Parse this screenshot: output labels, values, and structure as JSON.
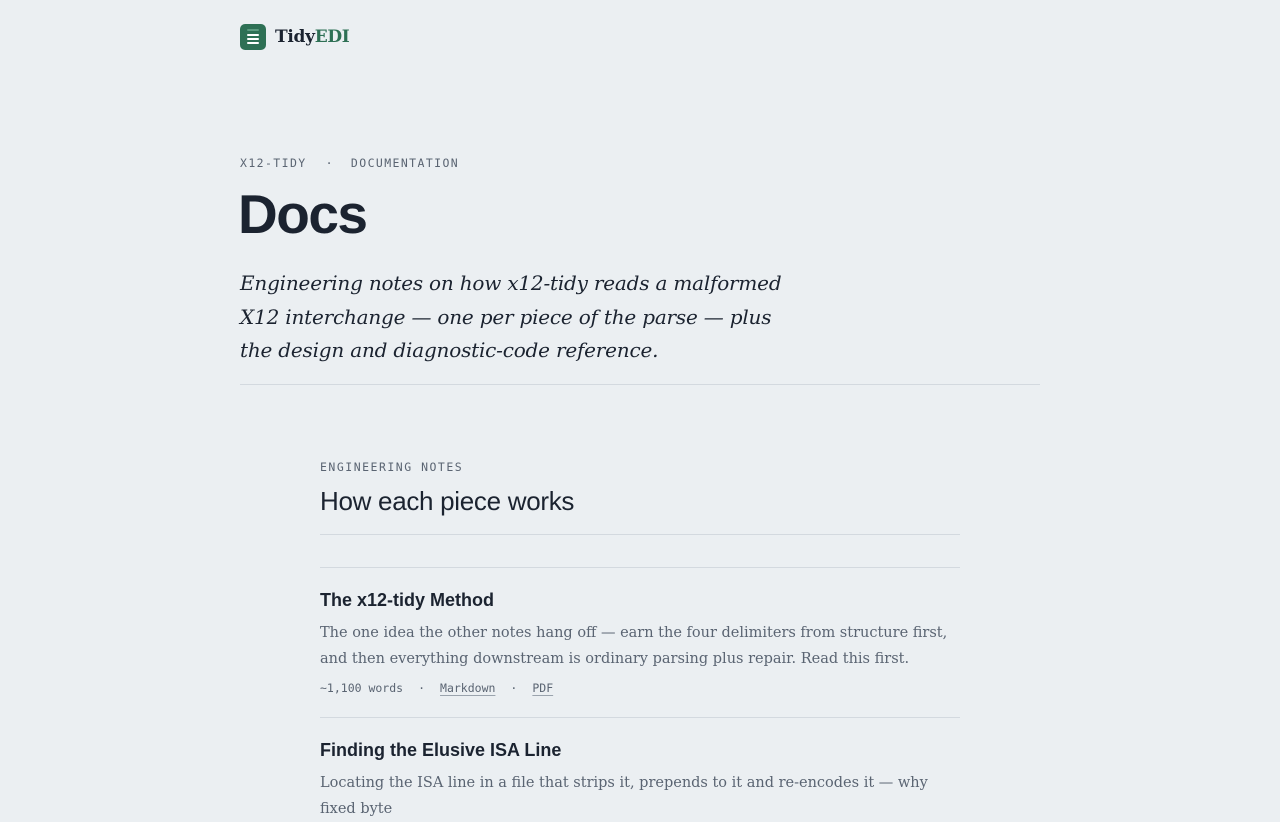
{
  "header": {
    "logo_icon": "stacked-lines-icon",
    "brand_part1": "Tidy",
    "brand_part2": "EDI"
  },
  "breadcrumb": {
    "project": "X12-TIDY",
    "separator": "·",
    "section": "DOCUMENTATION"
  },
  "page": {
    "title": "Docs",
    "lede": "Engineering notes on how x12-tidy reads a malformed X12 interchange — one per piece of the parse — plus the design and diagnostic-code reference."
  },
  "section": {
    "eyebrow": "ENGINEERING NOTES",
    "title": "How each piece works"
  },
  "notes": [
    {
      "title": "The x12-tidy Method",
      "description": "The one idea the other notes hang off — earn the four delimiters from structure first, and then everything downstream is ordinary parsing plus repair. Read this first.",
      "words": "~1,100 words",
      "separator": "·",
      "link_markdown": "Markdown",
      "link_pdf": "PDF"
    },
    {
      "title": "Finding the Elusive ISA Line",
      "description": "Locating the ISA line in a file that strips it, prepends to it and re-encodes it — why fixed byte"
    }
  ],
  "colors": {
    "background": "#ebeff2",
    "text": "#1b2330",
    "muted": "#5a6472",
    "brand_green": "#2e7055",
    "rule": "#d3d9df"
  }
}
